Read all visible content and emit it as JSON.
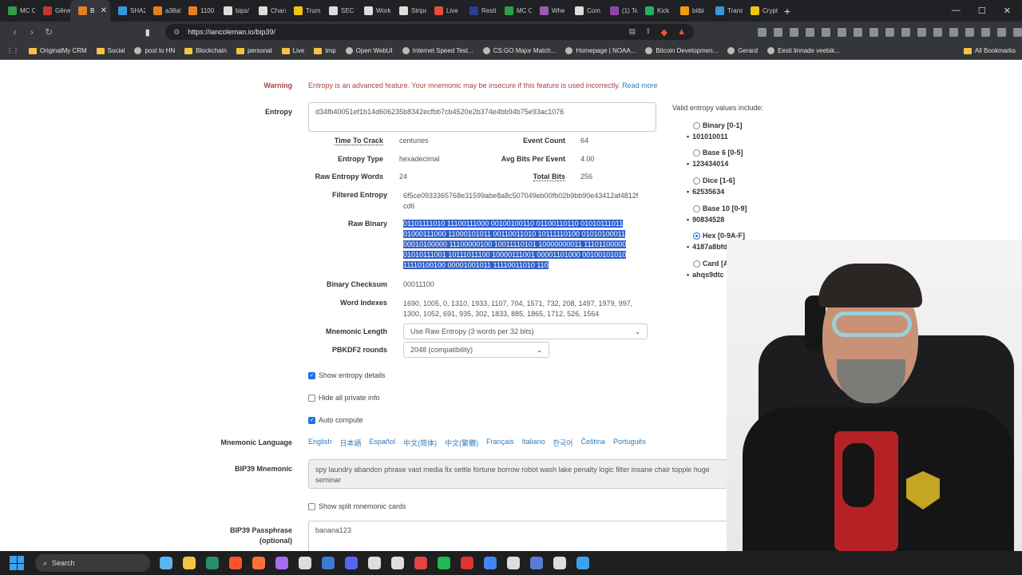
{
  "browser": {
    "tabs": [
      {
        "label": "MC C",
        "color": "#2f9d4a"
      },
      {
        "label": "Gêne",
        "color": "#c0392b"
      },
      {
        "label": "B",
        "color": "#e67e22",
        "active": true
      },
      {
        "label": "SHA2",
        "color": "#3498db"
      },
      {
        "label": "a38af",
        "color": "#e67e22"
      },
      {
        "label": "1100",
        "color": "#e67e22"
      },
      {
        "label": "bips/",
        "color": "#dddddd"
      },
      {
        "label": "Chars",
        "color": "#dddddd"
      },
      {
        "label": "Trum",
        "color": "#f1c40f"
      },
      {
        "label": "SEC V",
        "color": "#dddddd"
      },
      {
        "label": "Work",
        "color": "#dddddd"
      },
      {
        "label": "Stripe",
        "color": "#dddddd"
      },
      {
        "label": "Live",
        "color": "#e74c3c"
      },
      {
        "label": "Resti",
        "color": "#2c3e8f"
      },
      {
        "label": "MC C",
        "color": "#2f9d4a"
      },
      {
        "label": "Whe",
        "color": "#9b59b6"
      },
      {
        "label": "Com",
        "color": "#dddddd"
      },
      {
        "label": "(1) Te",
        "color": "#8e44ad"
      },
      {
        "label": "Kick",
        "color": "#27ae60"
      },
      {
        "label": "bitbi",
        "color": "#f39c12"
      },
      {
        "label": "Trans",
        "color": "#3498db"
      },
      {
        "label": "Crypt",
        "color": "#f1c40f"
      }
    ],
    "new_tab": "+",
    "url": "https://iancoleman.io/bip39/",
    "bookmarks": [
      {
        "label": "OriginalMy CRM",
        "kind": "folder"
      },
      {
        "label": "Social",
        "kind": "folder"
      },
      {
        "label": "post to HN",
        "kind": "site"
      },
      {
        "label": "Blockchain",
        "kind": "folder"
      },
      {
        "label": "personal",
        "kind": "folder"
      },
      {
        "label": "Live",
        "kind": "folder"
      },
      {
        "label": "tmp",
        "kind": "folder"
      },
      {
        "label": "Open WebUI",
        "kind": "site"
      },
      {
        "label": "Internet Speed Test...",
        "kind": "site"
      },
      {
        "label": "CS:GO Major Match...",
        "kind": "site"
      },
      {
        "label": "Homepage | NOAA...",
        "kind": "site"
      },
      {
        "label": "Bitcoin Developmen...",
        "kind": "site"
      },
      {
        "label": "Gerard",
        "kind": "site"
      },
      {
        "label": "Eesti linnade veebik...",
        "kind": "site"
      }
    ],
    "all_bookmarks": "All Bookmarks"
  },
  "page": {
    "warning_label": "Warning",
    "warning_text": "Entropy is an advanced feature. Your mnemonic may be insecure if this feature is used incorrectly.",
    "read_more": "Read more",
    "entropy_label": "Entropy",
    "entropy_value": "d34fb40051ef1b14d606235b8342ecfbb7cb4520e2b374e4bb94b75e93ac1076",
    "time_to_crack_label": "Time To Crack",
    "time_to_crack": "centuries",
    "event_count_label": "Event Count",
    "event_count": "64",
    "entropy_type_label": "Entropy Type",
    "entropy_type": "hexadecimal",
    "avg_bits_label": "Avg Bits Per Event",
    "avg_bits": "4.00",
    "raw_words_label": "Raw Entropy Words",
    "raw_words": "24",
    "total_bits_label": "Total Bits",
    "total_bits": "256",
    "filtered_label": "Filtered Entropy",
    "filtered_line1": "6f5ce0933365768e31599abe8a8c507049eb00fb02b9bb90e43412af4812f",
    "filtered_line2": "cd6",
    "raw_binary_label": "Raw Binary",
    "raw_binary": [
      "01101111010 11100111000 00100100110 01100110110 01010111011",
      "01000111000 11000101011 00110011010 10111110100 01010100011",
      "00010100000 11100000100 10011110101 10000000011 11101100000",
      "01010111001 10111011100 10000111001 00001101000 00100101010",
      "11110100100 00001001011 11110011010 110"
    ],
    "checksum_label": "Binary Checksum",
    "checksum": "00011100",
    "word_indexes_label": "Word Indexes",
    "word_indexes_line1": "1690, 1005, 0, 1310, 1933, 1107, 704, 1571, 732, 208, 1497, 1979, 997,",
    "word_indexes_line2": "1300, 1052, 691, 935, 302, 1833, 885, 1865, 1712, 526, 1564",
    "mnemonic_length_label": "Mnemonic Length",
    "mnemonic_length": "Use Raw Entropy (3 words per 32 bits)",
    "pbkdf2_label": "PBKDF2 rounds",
    "pbkdf2": "2048 (compatibility)",
    "show_entropy": "Show entropy details",
    "hide_private": "Hide all private info",
    "auto_compute": "Auto compute",
    "lang_label": "Mnemonic Language",
    "languages": [
      "English",
      "日本語",
      "Español",
      "中文(简体)",
      "中文(繁體)",
      "Français",
      "Italiano",
      "한국어",
      "Čeština",
      "Português"
    ],
    "bip39_label": "BIP39 Mnemonic",
    "bip39_line1": "spy laundry abandon phrase vast media fix settle fortune borrow robot wash lake penalty logic filter insane chair topple huge",
    "bip39_line2": "seminar",
    "split_cards": "Show split mnemonic cards",
    "passphrase_label_1": "BIP39 Passphrase",
    "passphrase_label_2": "(optional)",
    "passphrase": "banana123"
  },
  "sidebar": {
    "title": "Valid entropy values include:",
    "options": [
      {
        "label": "Binary [0-1]",
        "example": "101010011"
      },
      {
        "label": "Base 6 [0-5]",
        "example": "123434014"
      },
      {
        "label": "Dice [1-6]",
        "example": "62535634"
      },
      {
        "label": "Base 10 [0-9]",
        "example": "90834528"
      },
      {
        "label": "Hex [0-9A-F]",
        "example": "4187a8bfd9",
        "selected": true
      },
      {
        "label": "Card [A2-9TJQK][CDHS]",
        "example": "ahqs9dtc"
      }
    ]
  },
  "taskbar": {
    "search": "Search",
    "icon_colors": [
      "#5fb3f0",
      "#f4c344",
      "#2a8c6a",
      "#fb542b",
      "#ff7139",
      "#a56cf0",
      "#dddddd",
      "#3a7bd5",
      "#5865f2",
      "#dddddd",
      "#dddddd",
      "#e04444",
      "#1db954",
      "#d33",
      "#4285f4",
      "#dddddd",
      "#5a7bd5",
      "#dddddd",
      "#3aa3f0"
    ]
  }
}
